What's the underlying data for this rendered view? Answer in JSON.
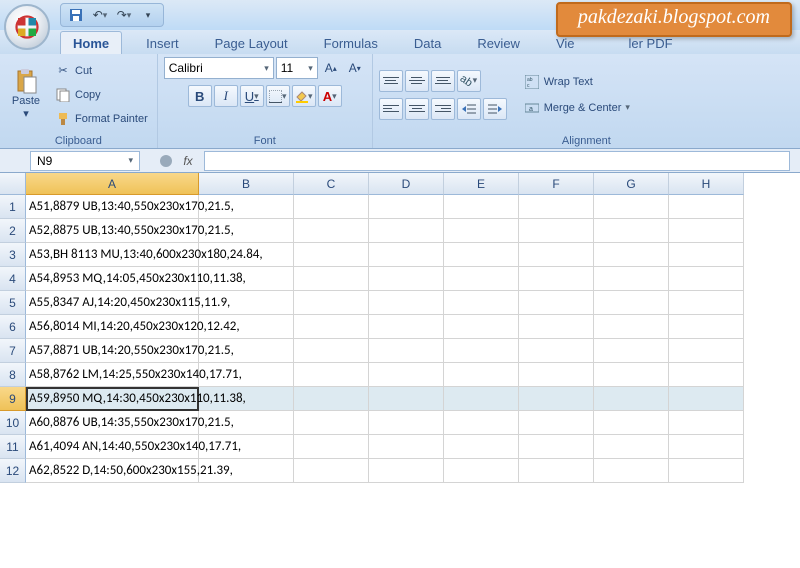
{
  "watermark": "pakdezaki.blogspot.com",
  "tabs": [
    "Home",
    "Insert",
    "Page Layout",
    "Formulas",
    "Data",
    "Review"
  ],
  "partial_tabs": [
    "Vie",
    "ler PDF"
  ],
  "active_tab_index": 0,
  "clipboard": {
    "paste": "Paste",
    "cut": "Cut",
    "copy": "Copy",
    "format_painter": "Format Painter",
    "group_label": "Clipboard"
  },
  "font": {
    "name": "Calibri",
    "size": "11",
    "bold": "B",
    "italic": "I",
    "underline": "U",
    "inc": "A↑",
    "dec": "A↓",
    "group_label": "Font"
  },
  "align": {
    "wrap": "Wrap Text",
    "merge": "Merge & Center",
    "group_label": "Alignment"
  },
  "namebox": "N9",
  "fx_label": "fx",
  "col_headers": [
    "A",
    "B",
    "C",
    "D",
    "E",
    "F",
    "G",
    "H"
  ],
  "selected_col_index": 0,
  "selected_row_index": 8,
  "rows": [
    {
      "n": "1",
      "a": "A51,8879 UB,13:40,550x230x170,21.5,"
    },
    {
      "n": "2",
      "a": "A52,8875 UB,13:40,550x230x170,21.5,"
    },
    {
      "n": "3",
      "a": "A53,BH 8113 MU,13:40,600x230x180,24.84,"
    },
    {
      "n": "4",
      "a": "A54,8953 MQ,14:05,450x230x110,11.38,"
    },
    {
      "n": "5",
      "a": "A55,8347 AJ,14:20,450x230x115,11.9,"
    },
    {
      "n": "6",
      "a": "A56,8014 MI,14:20,450x230x120,12.42,"
    },
    {
      "n": "7",
      "a": "A57,8871 UB,14:20,550x230x170,21.5,"
    },
    {
      "n": "8",
      "a": "A58,8762 LM,14:25,550x230x140,17.71,"
    },
    {
      "n": "9",
      "a": "A59,8950 MQ,14:30,450x230x110,11.38,"
    },
    {
      "n": "10",
      "a": "A60,8876 UB,14:35,550x230x170,21.5,"
    },
    {
      "n": "11",
      "a": "A61,4094 AN,14:40,550x230x140,17.71,"
    },
    {
      "n": "12",
      "a": "A62,8522 D,14:50,600x230x155,21.39,"
    }
  ]
}
